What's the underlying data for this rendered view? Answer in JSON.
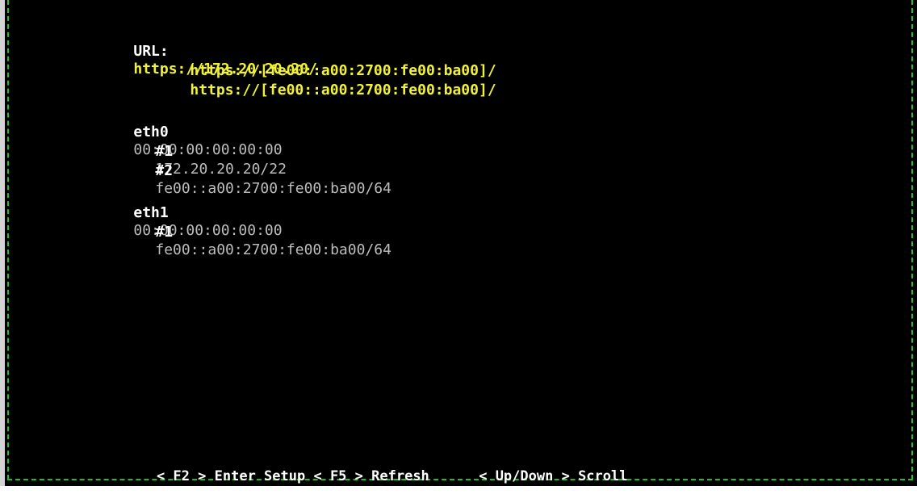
{
  "url_block": {
    "label": "URL:",
    "urls": [
      "https://172.20.20.20/",
      "https://[fe00::a00:2700:fe00:ba00]/",
      "https://[fe00::a00:2700:fe00:ba00]/"
    ]
  },
  "interfaces": [
    {
      "name": "eth0",
      "mac": "00:00:00:00:00:00",
      "addresses": [
        {
          "index": "#1",
          "address": "172.20.20.20/22"
        },
        {
          "index": "#2",
          "address": "fe00::a00:2700:fe00:ba00/64"
        }
      ]
    },
    {
      "name": "eth1",
      "mac": "00:00:00:00:00:00",
      "addresses": [
        {
          "index": "#1",
          "address": "fe00::a00:2700:fe00:ba00/64"
        }
      ]
    }
  ],
  "footer": {
    "setup_key": "< F2 >",
    "setup_label": "Enter Setup",
    "refresh_key": "< F5 >",
    "refresh_label": "Refresh",
    "scroll_key": "< Up/Down >",
    "scroll_label": "Scroll"
  },
  "colors": {
    "background": "#000000",
    "url_text": "#f2f235",
    "label_text": "#ffffff",
    "value_text": "#bdbdbd",
    "border": "#22c022"
  }
}
